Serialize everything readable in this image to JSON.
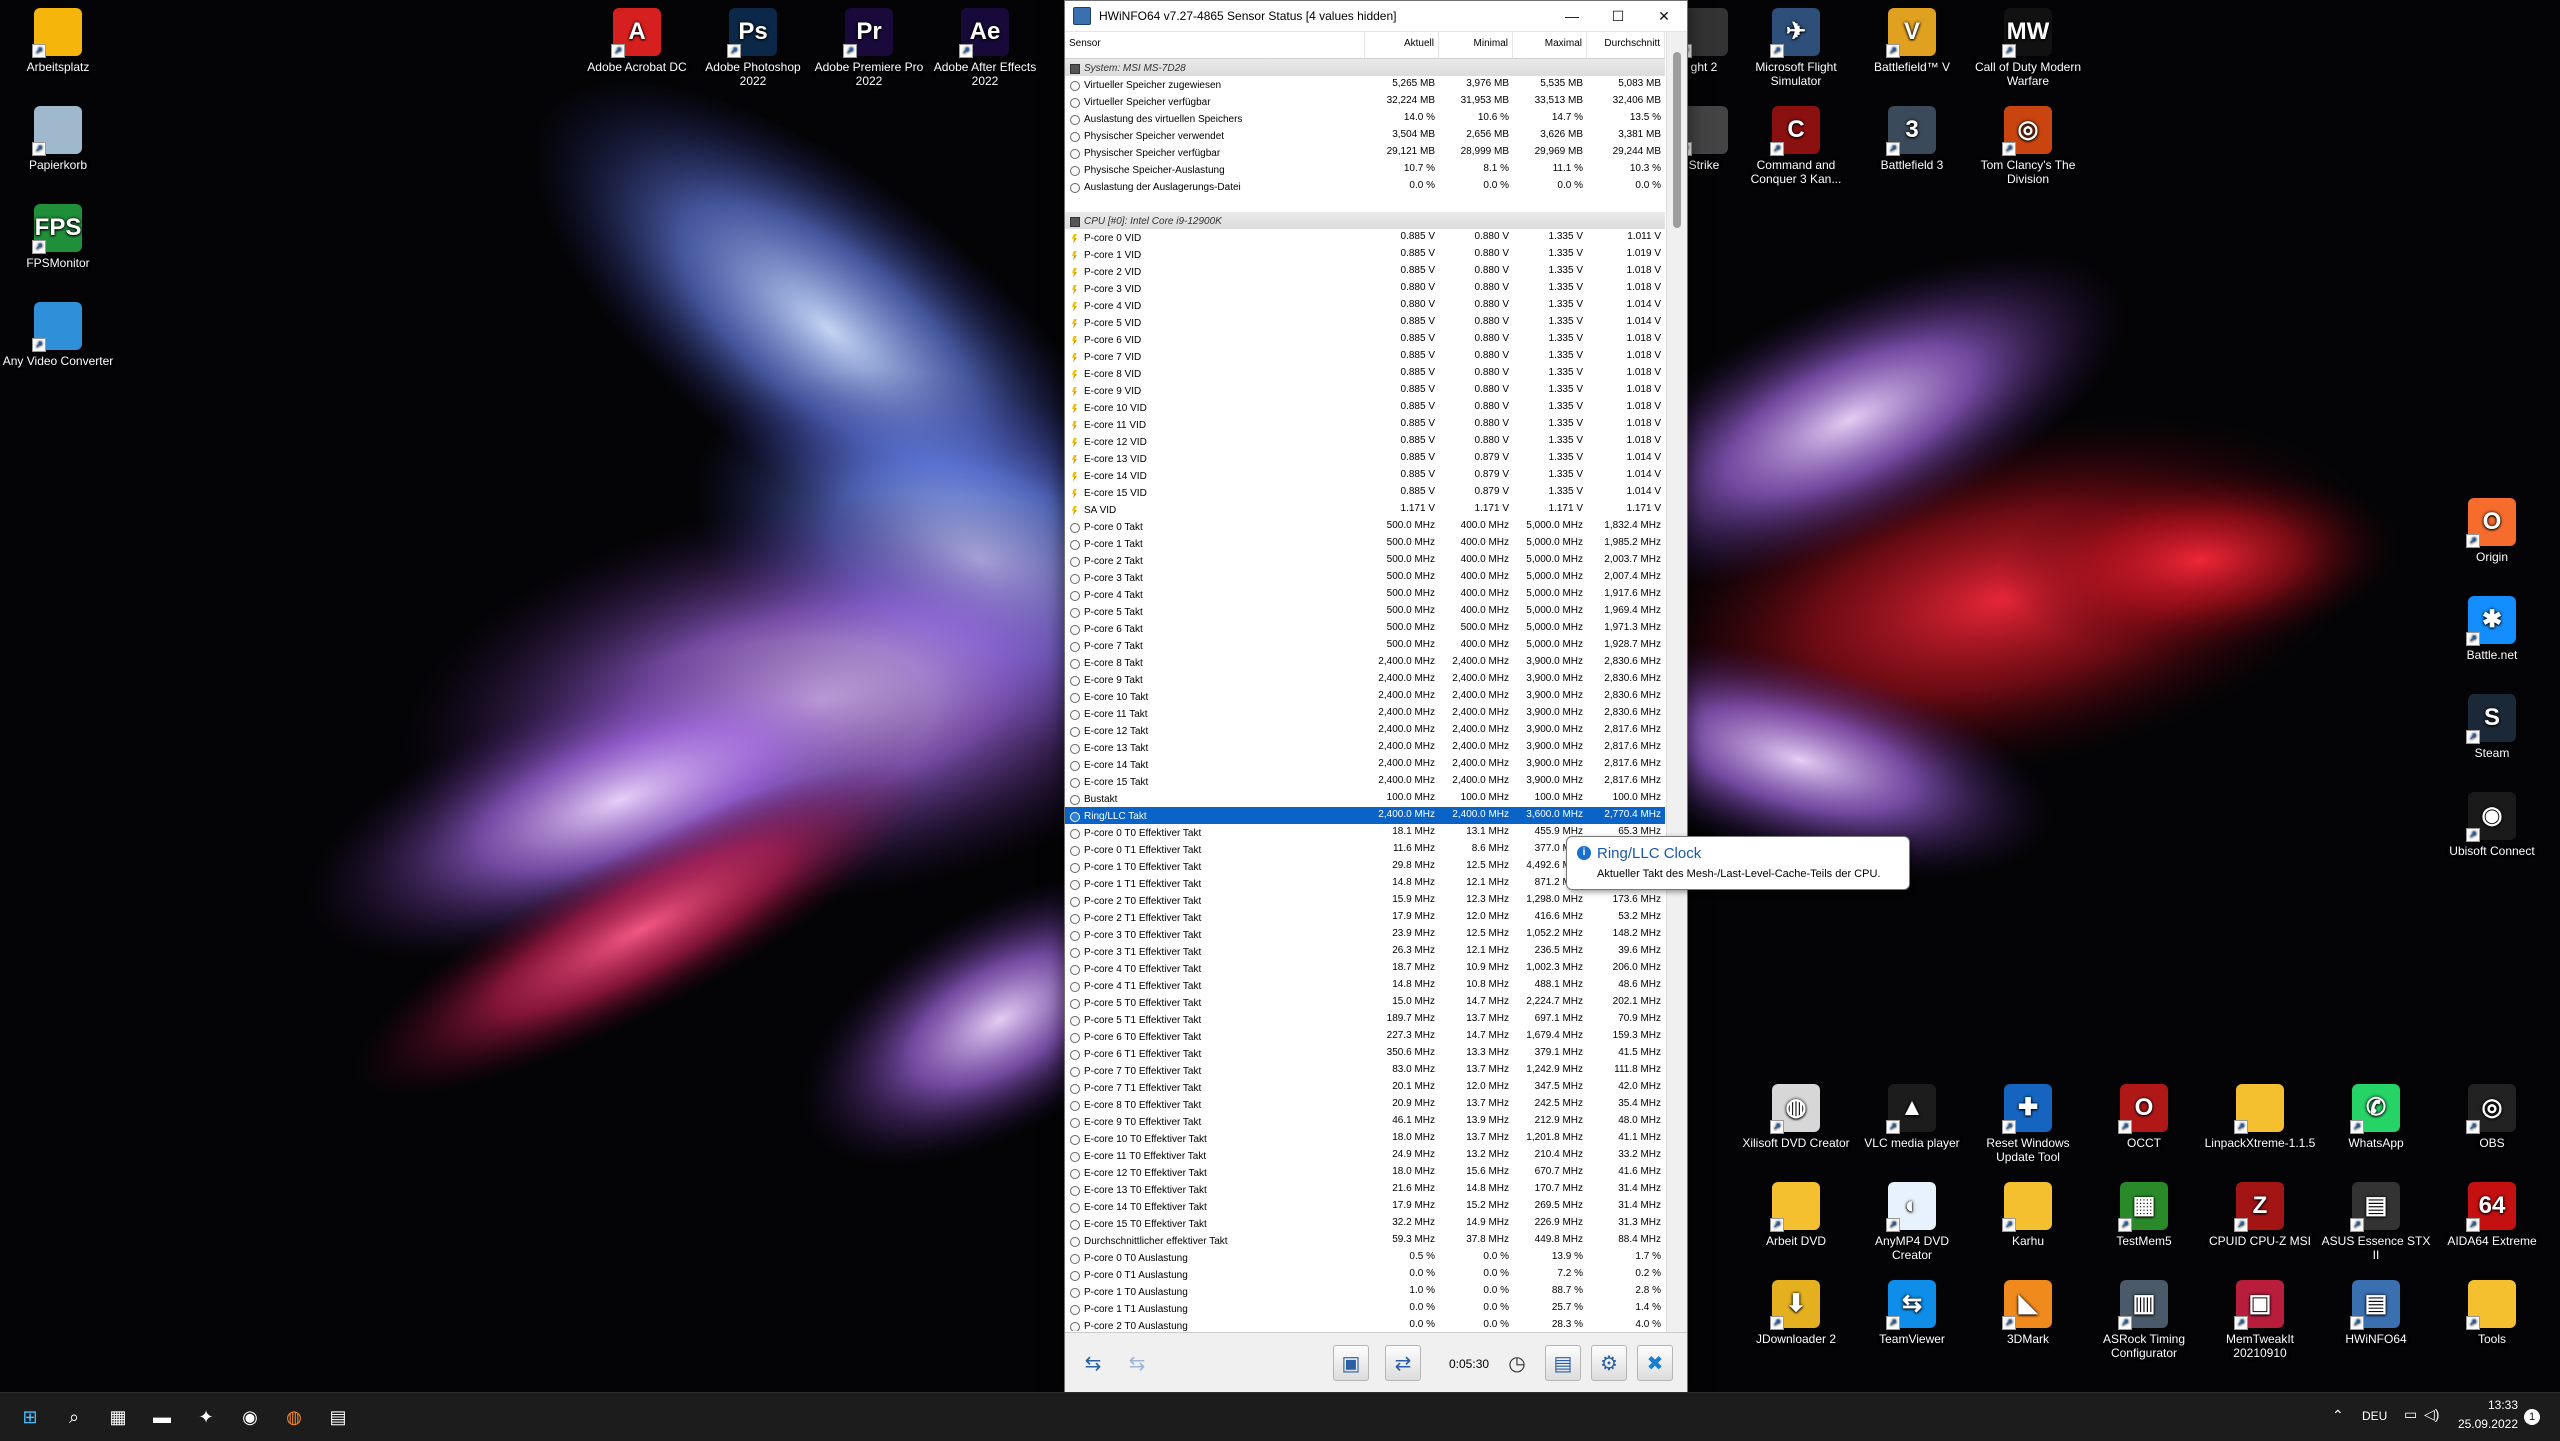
{
  "colors": {
    "accent": "#0a64c8",
    "taskbar": "#1c1c1c",
    "tooltip_title": "#1a56b0"
  },
  "desktop_icons_left": [
    {
      "label": "Arbeitsplatz",
      "icon": "folder-icon",
      "color": "#f5b50a",
      "glyph": ""
    },
    {
      "label": "Papierkorb",
      "icon": "recycle-bin-icon",
      "color": "#9fb8cc",
      "glyph": ""
    },
    {
      "label": "FPSMonitor",
      "icon": "fps-monitor-icon",
      "color": "#1f8f3a",
      "glyph": "FPS"
    },
    {
      "label": "Any Video Converter",
      "icon": "video-converter-icon",
      "color": "#2f8fd8",
      "glyph": ""
    }
  ],
  "desktop_icons_top": [
    {
      "label": "Adobe Acrobat DC",
      "icon": "acrobat-icon",
      "color": "#d61f1f",
      "glyph": "A"
    },
    {
      "label": "Adobe Photoshop 2022",
      "icon": "photoshop-icon",
      "color": "#0b2848",
      "glyph": "Ps"
    },
    {
      "label": "Adobe Premiere Pro 2022",
      "icon": "premiere-icon",
      "color": "#1a0a3c",
      "glyph": "Pr"
    },
    {
      "label": "Adobe After Effects 2022",
      "icon": "after-effects-icon",
      "color": "#170a3a",
      "glyph": "Ae"
    }
  ],
  "desktop_icons_right_top": [
    {
      "label": "ght 2",
      "icon": "game-icon",
      "color": "#333",
      "glyph": ""
    },
    {
      "label": "Microsoft Flight Simulator",
      "icon": "flight-sim-icon",
      "color": "#2d4f7a",
      "glyph": "✈"
    },
    {
      "label": "Battlefield™ V",
      "icon": "battlefield-v-icon",
      "color": "#e0a020",
      "glyph": "V"
    },
    {
      "label": "Call of Duty Modern Warfare",
      "icon": "cod-icon",
      "color": "#111",
      "glyph": "MW"
    },
    {
      "label": "Strike",
      "icon": "game-icon",
      "color": "#444",
      "glyph": ""
    },
    {
      "label": "Command and Conquer 3 Kan...",
      "icon": "cnc-icon",
      "color": "#8b1010",
      "glyph": "C"
    },
    {
      "label": "Battlefield 3",
      "icon": "battlefield-3-icon",
      "color": "#3a4a5a",
      "glyph": "3"
    },
    {
      "label": "Tom Clancy's The Division",
      "icon": "division-icon",
      "color": "#c9440e",
      "glyph": "◎"
    }
  ],
  "desktop_icons_right_side": [
    {
      "label": "Origin",
      "icon": "origin-icon",
      "color": "#f56c2d",
      "glyph": "O"
    },
    {
      "label": "Battle.net",
      "icon": "battlenet-icon",
      "color": "#148eff",
      "glyph": "✱"
    },
    {
      "label": "Steam",
      "icon": "steam-icon",
      "color": "#1b2838",
      "glyph": "S"
    },
    {
      "label": "Ubisoft Connect",
      "icon": "ubisoft-icon",
      "color": "#1a1a1a",
      "glyph": "◉"
    }
  ],
  "desktop_icons_bottom_r1": [
    {
      "label": "Xilisoft DVD Creator",
      "icon": "dvd-creator-icon",
      "color": "#d7d7d7",
      "glyph": "◍"
    },
    {
      "label": "VLC media player",
      "icon": "vlc-icon",
      "color": "#1c1c1c",
      "glyph": "▲"
    },
    {
      "label": "Reset Windows Update Tool",
      "icon": "windows-update-tool-icon",
      "color": "#1565c0",
      "glyph": "✚"
    },
    {
      "label": "OCCT",
      "icon": "occt-icon",
      "color": "#b01818",
      "glyph": "O"
    },
    {
      "label": "LinpackXtreme-1.1.5",
      "icon": "folder-icon",
      "color": "#f5c030",
      "glyph": ""
    },
    {
      "label": "WhatsApp",
      "icon": "whatsapp-icon",
      "color": "#25d366",
      "glyph": "✆"
    },
    {
      "label": "OBS",
      "icon": "obs-icon",
      "color": "#222",
      "glyph": "◎"
    }
  ],
  "desktop_icons_bottom_r2": [
    {
      "label": "Arbeit DVD",
      "icon": "folder-icon",
      "color": "#f5c030",
      "glyph": ""
    },
    {
      "label": "AnyMP4 DVD Creator",
      "icon": "anymp4-icon",
      "color": "#e8f2ff",
      "glyph": "◐"
    },
    {
      "label": "Karhu",
      "icon": "folder-icon",
      "color": "#f5c030",
      "glyph": ""
    },
    {
      "label": "TestMem5",
      "icon": "testmem-icon",
      "color": "#2a8a2a",
      "glyph": "▦"
    },
    {
      "label": "CPUID CPU-Z MSI",
      "icon": "cpuz-icon",
      "color": "#a31515",
      "glyph": "Z"
    },
    {
      "label": "ASUS Essence STX II",
      "icon": "asus-icon",
      "color": "#333",
      "glyph": "▤"
    },
    {
      "label": "AIDA64 Extreme",
      "icon": "aida64-icon",
      "color": "#c41010",
      "glyph": "64"
    }
  ],
  "desktop_icons_bottom_r3": [
    {
      "label": "JDownloader 2",
      "icon": "jdownloader-icon",
      "color": "#e4b020",
      "glyph": "⬇"
    },
    {
      "label": "TeamViewer",
      "icon": "teamviewer-icon",
      "color": "#0e8ee9",
      "glyph": "⇆"
    },
    {
      "label": "3DMark",
      "icon": "3dmark-icon",
      "color": "#f08a1c",
      "glyph": "◣"
    },
    {
      "label": "ASRock Timing Configurator",
      "icon": "asrock-icon",
      "color": "#4a5a6a",
      "glyph": "▥"
    },
    {
      "label": "MemTweakIt 20210910",
      "icon": "memtweakit-icon",
      "color": "#b81d3c",
      "glyph": "▣"
    },
    {
      "label": "HWiNFO64",
      "icon": "hwinfo-icon",
      "color": "#3a6fb0",
      "glyph": "▤"
    },
    {
      "label": "Tools",
      "icon": "folder-icon",
      "color": "#f5c030",
      "glyph": ""
    }
  ],
  "window": {
    "title": "HWiNFO64 v7.27-4865 Sensor Status [4 values hidden]",
    "columns": [
      "Sensor",
      "Aktuell",
      "Minimal",
      "Maximal",
      "Durchschnitt"
    ],
    "timer": "0:05:30",
    "tooltip_title": "Ring/LLC Clock",
    "tooltip_text": "Aktueller Takt des Mesh-/Last-Level-Cache-Teils der CPU."
  },
  "rows": [
    {
      "t": "group",
      "n": "System: MSI MS-7D28"
    },
    {
      "t": "clock",
      "n": "Virtueller Speicher zugewiesen",
      "a": "5,265 MB",
      "mi": "3,976 MB",
      "ma": "5,535 MB",
      "d": "5,083 MB"
    },
    {
      "t": "clock",
      "n": "Virtueller Speicher verfügbar",
      "a": "32,224 MB",
      "mi": "31,953 MB",
      "ma": "33,513 MB",
      "d": "32,406 MB"
    },
    {
      "t": "clock",
      "n": "Auslastung des virtuellen Speichers",
      "a": "14.0 %",
      "mi": "10.6 %",
      "ma": "14.7 %",
      "d": "13.5 %"
    },
    {
      "t": "clock",
      "n": "Physischer Speicher verwendet",
      "a": "3,504 MB",
      "mi": "2,656 MB",
      "ma": "3,626 MB",
      "d": "3,381 MB"
    },
    {
      "t": "clock",
      "n": "Physischer Speicher verfügbar",
      "a": "29,121 MB",
      "mi": "28,999 MB",
      "ma": "29,969 MB",
      "d": "29,244 MB"
    },
    {
      "t": "clock",
      "n": "Physische Speicher-Auslastung",
      "a": "10.7 %",
      "mi": "8.1 %",
      "ma": "11.1 %",
      "d": "10.3 %"
    },
    {
      "t": "clock",
      "n": "Auslastung der Auslagerungs-Datei",
      "a": "0.0 %",
      "mi": "0.0 %",
      "ma": "0.0 %",
      "d": "0.0 %"
    },
    {
      "t": "blank",
      "n": ""
    },
    {
      "t": "group",
      "n": "CPU [#0]: Intel Core i9-12900K"
    },
    {
      "t": "bolt",
      "n": "P-core 0 VID",
      "a": "0.885 V",
      "mi": "0.880 V",
      "ma": "1.335 V",
      "d": "1.011 V"
    },
    {
      "t": "bolt",
      "n": "P-core 1 VID",
      "a": "0.885 V",
      "mi": "0.880 V",
      "ma": "1.335 V",
      "d": "1.019 V"
    },
    {
      "t": "bolt",
      "n": "P-core 2 VID",
      "a": "0.885 V",
      "mi": "0.880 V",
      "ma": "1.335 V",
      "d": "1.018 V"
    },
    {
      "t": "bolt",
      "n": "P-core 3 VID",
      "a": "0.880 V",
      "mi": "0.880 V",
      "ma": "1.335 V",
      "d": "1.018 V"
    },
    {
      "t": "bolt",
      "n": "P-core 4 VID",
      "a": "0.880 V",
      "mi": "0.880 V",
      "ma": "1.335 V",
      "d": "1.014 V"
    },
    {
      "t": "bolt",
      "n": "P-core 5 VID",
      "a": "0.885 V",
      "mi": "0.880 V",
      "ma": "1.335 V",
      "d": "1.014 V"
    },
    {
      "t": "bolt",
      "n": "P-core 6 VID",
      "a": "0.885 V",
      "mi": "0.880 V",
      "ma": "1.335 V",
      "d": "1.018 V"
    },
    {
      "t": "bolt",
      "n": "P-core 7 VID",
      "a": "0.885 V",
      "mi": "0.880 V",
      "ma": "1.335 V",
      "d": "1.018 V"
    },
    {
      "t": "bolt",
      "n": "E-core 8 VID",
      "a": "0.885 V",
      "mi": "0.880 V",
      "ma": "1.335 V",
      "d": "1.018 V"
    },
    {
      "t": "bolt",
      "n": "E-core 9 VID",
      "a": "0.885 V",
      "mi": "0.880 V",
      "ma": "1.335 V",
      "d": "1.018 V"
    },
    {
      "t": "bolt",
      "n": "E-core 10 VID",
      "a": "0.885 V",
      "mi": "0.880 V",
      "ma": "1.335 V",
      "d": "1.018 V"
    },
    {
      "t": "bolt",
      "n": "E-core 11 VID",
      "a": "0.885 V",
      "mi": "0.880 V",
      "ma": "1.335 V",
      "d": "1.018 V"
    },
    {
      "t": "bolt",
      "n": "E-core 12 VID",
      "a": "0.885 V",
      "mi": "0.880 V",
      "ma": "1.335 V",
      "d": "1.018 V"
    },
    {
      "t": "bolt",
      "n": "E-core 13 VID",
      "a": "0.885 V",
      "mi": "0.879 V",
      "ma": "1.335 V",
      "d": "1.014 V"
    },
    {
      "t": "bolt",
      "n": "E-core 14 VID",
      "a": "0.885 V",
      "mi": "0.879 V",
      "ma": "1.335 V",
      "d": "1.014 V"
    },
    {
      "t": "bolt",
      "n": "E-core 15 VID",
      "a": "0.885 V",
      "mi": "0.879 V",
      "ma": "1.335 V",
      "d": "1.014 V"
    },
    {
      "t": "bolt",
      "n": "SA VID",
      "a": "1.171 V",
      "mi": "1.171 V",
      "ma": "1.171 V",
      "d": "1.171 V"
    },
    {
      "t": "clock",
      "n": "P-core 0 Takt",
      "a": "500.0 MHz",
      "mi": "400.0 MHz",
      "ma": "5,000.0 MHz",
      "d": "1,832.4 MHz"
    },
    {
      "t": "clock",
      "n": "P-core 1 Takt",
      "a": "500.0 MHz",
      "mi": "400.0 MHz",
      "ma": "5,000.0 MHz",
      "d": "1,985.2 MHz"
    },
    {
      "t": "clock",
      "n": "P-core 2 Takt",
      "a": "500.0 MHz",
      "mi": "400.0 MHz",
      "ma": "5,000.0 MHz",
      "d": "2,003.7 MHz"
    },
    {
      "t": "clock",
      "n": "P-core 3 Takt",
      "a": "500.0 MHz",
      "mi": "400.0 MHz",
      "ma": "5,000.0 MHz",
      "d": "2,007.4 MHz"
    },
    {
      "t": "clock",
      "n": "P-core 4 Takt",
      "a": "500.0 MHz",
      "mi": "400.0 MHz",
      "ma": "5,000.0 MHz",
      "d": "1,917.6 MHz"
    },
    {
      "t": "clock",
      "n": "P-core 5 Takt",
      "a": "500.0 MHz",
      "mi": "400.0 MHz",
      "ma": "5,000.0 MHz",
      "d": "1,969.4 MHz"
    },
    {
      "t": "clock",
      "n": "P-core 6 Takt",
      "a": "500.0 MHz",
      "mi": "500.0 MHz",
      "ma": "5,000.0 MHz",
      "d": "1,971.3 MHz"
    },
    {
      "t": "clock",
      "n": "P-core 7 Takt",
      "a": "500.0 MHz",
      "mi": "400.0 MHz",
      "ma": "5,000.0 MHz",
      "d": "1,928.7 MHz"
    },
    {
      "t": "clock",
      "n": "E-core 8 Takt",
      "a": "2,400.0 MHz",
      "mi": "2,400.0 MHz",
      "ma": "3,900.0 MHz",
      "d": "2,830.6 MHz"
    },
    {
      "t": "clock",
      "n": "E-core 9 Takt",
      "a": "2,400.0 MHz",
      "mi": "2,400.0 MHz",
      "ma": "3,900.0 MHz",
      "d": "2,830.6 MHz"
    },
    {
      "t": "clock",
      "n": "E-core 10 Takt",
      "a": "2,400.0 MHz",
      "mi": "2,400.0 MHz",
      "ma": "3,900.0 MHz",
      "d": "2,830.6 MHz"
    },
    {
      "t": "clock",
      "n": "E-core 11 Takt",
      "a": "2,400.0 MHz",
      "mi": "2,400.0 MHz",
      "ma": "3,900.0 MHz",
      "d": "2,830.6 MHz"
    },
    {
      "t": "clock",
      "n": "E-core 12 Takt",
      "a": "2,400.0 MHz",
      "mi": "2,400.0 MHz",
      "ma": "3,900.0 MHz",
      "d": "2,817.6 MHz"
    },
    {
      "t": "clock",
      "n": "E-core 13 Takt",
      "a": "2,400.0 MHz",
      "mi": "2,400.0 MHz",
      "ma": "3,900.0 MHz",
      "d": "2,817.6 MHz"
    },
    {
      "t": "clock",
      "n": "E-core 14 Takt",
      "a": "2,400.0 MHz",
      "mi": "2,400.0 MHz",
      "ma": "3,900.0 MHz",
      "d": "2,817.6 MHz"
    },
    {
      "t": "clock",
      "n": "E-core 15 Takt",
      "a": "2,400.0 MHz",
      "mi": "2,400.0 MHz",
      "ma": "3,900.0 MHz",
      "d": "2,817.6 MHz"
    },
    {
      "t": "clock",
      "n": "Bustakt",
      "a": "100.0 MHz",
      "mi": "100.0 MHz",
      "ma": "100.0 MHz",
      "d": "100.0 MHz"
    },
    {
      "t": "sel",
      "n": "Ring/LLC Takt",
      "a": "2,400.0 MHz",
      "mi": "2,400.0 MHz",
      "ma": "3,600.0 MHz",
      "d": "2,770.4 MHz"
    },
    {
      "t": "clock",
      "n": "P-core 0 T0 Effektiver Takt",
      "a": "18.1 MHz",
      "mi": "13.1 MHz",
      "ma": "455.9 MHz",
      "d": "65.3 MHz"
    },
    {
      "t": "clock",
      "n": "P-core 0 T1 Effektiver Takt",
      "a": "11.6 MHz",
      "mi": "8.6 MHz",
      "ma": "377.0 MHz",
      "d": "47.1 MHz"
    },
    {
      "t": "clock",
      "n": "P-core 1 T0 Effektiver Takt",
      "a": "29.8 MHz",
      "mi": "12.5 MHz",
      "ma": "4,492.6 MHz",
      "d": "259.2 MHz"
    },
    {
      "t": "clock",
      "n": "P-core 1 T1 Effektiver Takt",
      "a": "14.8 MHz",
      "mi": "12.1 MHz",
      "ma": "871.2 MHz",
      "d": "62.4 MHz"
    },
    {
      "t": "clock",
      "n": "P-core 2 T0 Effektiver Takt",
      "a": "15.9 MHz",
      "mi": "12.3 MHz",
      "ma": "1,298.0 MHz",
      "d": "173.6 MHz"
    },
    {
      "t": "clock",
      "n": "P-core 2 T1 Effektiver Takt",
      "a": "17.9 MHz",
      "mi": "12.0 MHz",
      "ma": "416.6 MHz",
      "d": "53.2 MHz"
    },
    {
      "t": "clock",
      "n": "P-core 3 T0 Effektiver Takt",
      "a": "23.9 MHz",
      "mi": "12.5 MHz",
      "ma": "1,052.2 MHz",
      "d": "148.2 MHz"
    },
    {
      "t": "clock",
      "n": "P-core 3 T1 Effektiver Takt",
      "a": "26.3 MHz",
      "mi": "12.1 MHz",
      "ma": "236.5 MHz",
      "d": "39.6 MHz"
    },
    {
      "t": "clock",
      "n": "P-core 4 T0 Effektiver Takt",
      "a": "18.7 MHz",
      "mi": "10.9 MHz",
      "ma": "1,002.3 MHz",
      "d": "206.0 MHz"
    },
    {
      "t": "clock",
      "n": "P-core 4 T1 Effektiver Takt",
      "a": "14.8 MHz",
      "mi": "10.8 MHz",
      "ma": "488.1 MHz",
      "d": "48.6 MHz"
    },
    {
      "t": "clock",
      "n": "P-core 5 T0 Effektiver Takt",
      "a": "15.0 MHz",
      "mi": "14.7 MHz",
      "ma": "2,224.7 MHz",
      "d": "202.1 MHz"
    },
    {
      "t": "clock",
      "n": "P-core 5 T1 Effektiver Takt",
      "a": "189.7 MHz",
      "mi": "13.7 MHz",
      "ma": "697.1 MHz",
      "d": "70.9 MHz"
    },
    {
      "t": "clock",
      "n": "P-core 6 T0 Effektiver Takt",
      "a": "227.3 MHz",
      "mi": "14.7 MHz",
      "ma": "1,679.4 MHz",
      "d": "159.3 MHz"
    },
    {
      "t": "clock",
      "n": "P-core 6 T1 Effektiver Takt",
      "a": "350.6 MHz",
      "mi": "13.3 MHz",
      "ma": "379.1 MHz",
      "d": "41.5 MHz"
    },
    {
      "t": "clock",
      "n": "P-core 7 T0 Effektiver Takt",
      "a": "83.0 MHz",
      "mi": "13.7 MHz",
      "ma": "1,242.9 MHz",
      "d": "111.8 MHz"
    },
    {
      "t": "clock",
      "n": "P-core 7 T1 Effektiver Takt",
      "a": "20.1 MHz",
      "mi": "12.0 MHz",
      "ma": "347.5 MHz",
      "d": "42.0 MHz"
    },
    {
      "t": "clock",
      "n": "E-core 8 T0 Effektiver Takt",
      "a": "20.9 MHz",
      "mi": "13.7 MHz",
      "ma": "242.5 MHz",
      "d": "35.4 MHz"
    },
    {
      "t": "clock",
      "n": "E-core 9 T0 Effektiver Takt",
      "a": "46.1 MHz",
      "mi": "13.9 MHz",
      "ma": "212.9 MHz",
      "d": "48.0 MHz"
    },
    {
      "t": "clock",
      "n": "E-core 10 T0 Effektiver Takt",
      "a": "18.0 MHz",
      "mi": "13.7 MHz",
      "ma": "1,201.8 MHz",
      "d": "41.1 MHz"
    },
    {
      "t": "clock",
      "n": "E-core 11 T0 Effektiver Takt",
      "a": "24.9 MHz",
      "mi": "13.2 MHz",
      "ma": "210.4 MHz",
      "d": "33.2 MHz"
    },
    {
      "t": "clock",
      "n": "E-core 12 T0 Effektiver Takt",
      "a": "18.0 MHz",
      "mi": "15.6 MHz",
      "ma": "670.7 MHz",
      "d": "41.6 MHz"
    },
    {
      "t": "clock",
      "n": "E-core 13 T0 Effektiver Takt",
      "a": "21.6 MHz",
      "mi": "14.8 MHz",
      "ma": "170.7 MHz",
      "d": "31.4 MHz"
    },
    {
      "t": "clock",
      "n": "E-core 14 T0 Effektiver Takt",
      "a": "17.9 MHz",
      "mi": "15.2 MHz",
      "ma": "269.5 MHz",
      "d": "31.4 MHz"
    },
    {
      "t": "clock",
      "n": "E-core 15 T0 Effektiver Takt",
      "a": "32.2 MHz",
      "mi": "14.9 MHz",
      "ma": "226.9 MHz",
      "d": "31.3 MHz"
    },
    {
      "t": "clock",
      "n": "Durchschnittlicher effektiver Takt",
      "a": "59.3 MHz",
      "mi": "37.8 MHz",
      "ma": "449.8 MHz",
      "d": "88.4 MHz"
    },
    {
      "t": "clock",
      "n": "P-core 0 T0 Auslastung",
      "a": "0.5 %",
      "mi": "0.0 %",
      "ma": "13.9 %",
      "d": "1.7 %"
    },
    {
      "t": "clock",
      "n": "P-core 0 T1 Auslastung",
      "a": "0.0 %",
      "mi": "0.0 %",
      "ma": "7.2 %",
      "d": "0.2 %"
    },
    {
      "t": "clock",
      "n": "P-core 1 T0 Auslastung",
      "a": "1.0 %",
      "mi": "0.0 %",
      "ma": "88.7 %",
      "d": "2.8 %"
    },
    {
      "t": "clock",
      "n": "P-core 1 T1 Auslastung",
      "a": "0.0 %",
      "mi": "0.0 %",
      "ma": "25.7 %",
      "d": "1.4 %"
    },
    {
      "t": "clock",
      "n": "P-core 2 T0 Auslastung",
      "a": "0.0 %",
      "mi": "0.0 %",
      "ma": "28.3 %",
      "d": "4.0 %"
    }
  ],
  "taskbar": {
    "apps": [
      {
        "icon": "windows-start-icon",
        "glyph": "⊞"
      },
      {
        "icon": "search-icon",
        "glyph": "⌕"
      },
      {
        "icon": "store-icon",
        "glyph": "▦"
      },
      {
        "icon": "file-explorer-icon",
        "glyph": "▬"
      },
      {
        "icon": "app-icon",
        "glyph": "✦"
      },
      {
        "icon": "chat-icon",
        "glyph": "◉"
      },
      {
        "icon": "firefox-icon",
        "glyph": "◍"
      },
      {
        "icon": "hwinfo-taskbar-icon",
        "glyph": "▤"
      }
    ],
    "lang": "DEU",
    "time": "13:33",
    "date": "25.09.2022",
    "notif": "1"
  }
}
